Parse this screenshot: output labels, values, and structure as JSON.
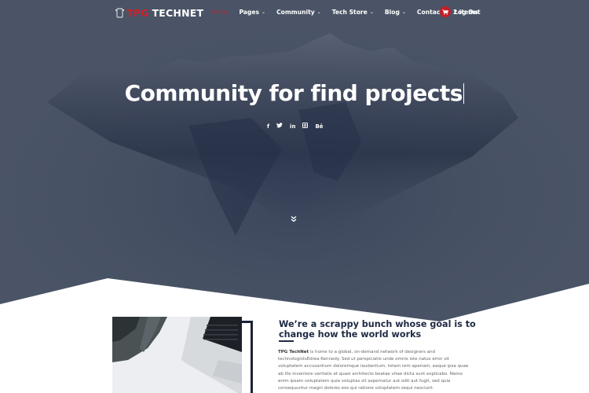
{
  "brand": {
    "logo_prefix": "TPG",
    "logo_suffix": "TECHNET",
    "accent_color": "#d0202a",
    "hero_color": "#4a5466",
    "heading_color": "#1e2a45"
  },
  "nav": {
    "items": [
      {
        "label": "Home",
        "active": true,
        "has_dropdown": false
      },
      {
        "label": "Pages",
        "active": false,
        "has_dropdown": true
      },
      {
        "label": "Community",
        "active": false,
        "has_dropdown": true
      },
      {
        "label": "Tech Store",
        "active": false,
        "has_dropdown": true
      },
      {
        "label": "Blog",
        "active": false,
        "has_dropdown": true
      },
      {
        "label": "Contact",
        "active": false,
        "has_dropdown": false
      },
      {
        "label": "Log Out",
        "active": false,
        "has_dropdown": false
      }
    ],
    "cart": {
      "icon": "cart-icon",
      "label": "2 items"
    }
  },
  "hero": {
    "title": "Community for find projects",
    "social": [
      {
        "name": "facebook",
        "glyph": "f"
      },
      {
        "name": "twitter",
        "glyph": "t"
      },
      {
        "name": "linkedin",
        "glyph": "in"
      },
      {
        "name": "instagram",
        "glyph": "ig"
      },
      {
        "name": "behance",
        "glyph": "Bē"
      }
    ],
    "scroll_icon": "double-chevron-down-icon"
  },
  "about": {
    "heading": "We’re a scrappy bunch whose goal is to change how the world works",
    "body_strong": "TPG TechNet",
    "body": " is home to a global, on-demand network of designers and technologistsEdrea Kennedy. Sed ut perspiciatis unde omnis iste natus error sit voluptatem accusantium doloremque laudantium, totam rem aperiam, eaque ipsa quae ab illo inventore veritatis et quasi architecto beatae vitae dicta sunt explicabo. Nemo enim ipsam voluptatem quia voluptas sit aspernatur aut odit aut fugit, sed quia consequuntur magni dolores eos qui ratione voluptatem sequi nesciunt."
  }
}
